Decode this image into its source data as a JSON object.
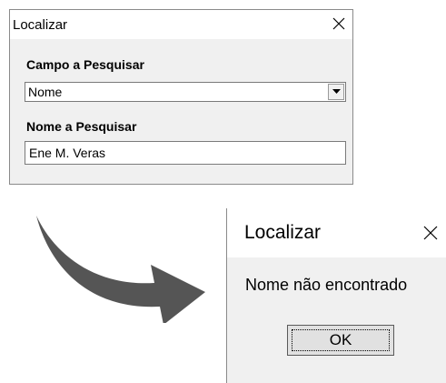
{
  "search_dialog": {
    "title": "Localizar",
    "close_icon": "close-icon",
    "field_label": "Campo a Pesquisar",
    "field_value": "Nome",
    "dropdown_icon": "chevron-down-icon",
    "name_label": "Nome a Pesquisar",
    "name_value": "Ene M. Veras"
  },
  "arrow": {
    "icon": "curved-arrow-icon",
    "color": "#555555"
  },
  "message_dialog": {
    "title": "Localizar",
    "close_icon": "close-icon",
    "message": "Nome não encontrado",
    "ok_label": "OK"
  }
}
